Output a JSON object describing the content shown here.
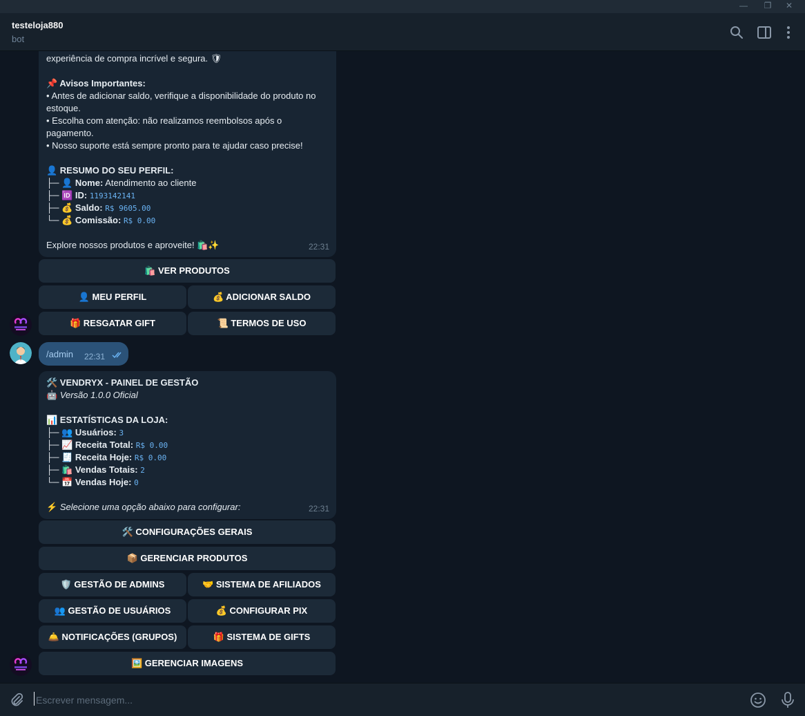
{
  "window": {
    "minimize": "—",
    "restore": "❐",
    "close": "✕"
  },
  "header": {
    "title": "testeloja880",
    "subtitle": "bot",
    "search_icon": "search-icon",
    "sidebar_icon": "sidebar-toggle-icon",
    "menu_icon": "more-vertical-icon"
  },
  "msg1": {
    "lines": [
      "experiência de compra incrível e segura. 🛡",
      "",
      "📌 Avisos Importantes:",
      "• Antes de adicionar saldo, verifique a disponibilidade do produto no",
      "estoque.",
      "• Escolha com atenção: não realizamos reembolsos após o",
      "pagamento.",
      "• Nosso suporte está sempre pronto para te ajudar caso precise!",
      "",
      "👤 RESUMO DO SEU PERFIL:",
      "├─ 👤 Nome: Atendimento ao cliente",
      "├─ 🆔 ID: 1193142141",
      "├─ 💰 Saldo: R$ 9605.00",
      "└─ 💰 Comissão: R$ 0.00",
      "",
      "Explore nossos produtos e aproveite! 🛍️✨"
    ],
    "avisos_heading": "📌 Avisos Importantes:",
    "resumo_heading": "👤 RESUMO DO SEU PERFIL:",
    "nome_label": "Nome:",
    "nome_value": "Atendimento ao cliente",
    "id_label": "ID:",
    "id_value": "1193142141",
    "saldo_label": "Saldo:",
    "saldo_value": "R$ 9605.00",
    "comissao_label": "Comissão:",
    "comissao_value": "R$ 0.00",
    "time": "22:31"
  },
  "keyboard1": {
    "ver_produtos": "🛍️ VER PRODUTOS",
    "meu_perfil": "👤 MEU PERFIL",
    "adicionar_saldo": "💰 ADICIONAR SALDO",
    "resgatar_gift": "🎁 RESGATAR GIFT",
    "termos_de_uso": "📜 TERMOS DE USO"
  },
  "outgoing": {
    "text": "/admin",
    "time": "22:31",
    "status": "read"
  },
  "msg2": {
    "title": "🛠️ VENDRYX - PAINEL DE GESTÃO",
    "version": "Versão 1.0.0 Oficial",
    "stats_heading": "📊 ESTATÍSTICAS DA LOJA:",
    "usuarios_label": "Usuários:",
    "usuarios_value": "3",
    "receita_total_label": "Receita Total:",
    "receita_total_value": "R$ 0.00",
    "receita_hoje_label": "Receita Hoje:",
    "receita_hoje_value": "R$ 0.00",
    "vendas_totais_label": "Vendas Totais:",
    "vendas_totais_value": "2",
    "vendas_hoje_label": "Vendas Hoje:",
    "vendas_hoje_value": "0",
    "prompt": "Selecione uma opção abaixo para configurar:",
    "time": "22:31"
  },
  "keyboard2": {
    "configuracoes_gerais": "🛠️ CONFIGURAÇÕES GERAIS",
    "gerenciar_produtos": "📦 GERENCIAR PRODUTOS",
    "gestao_admins": "🛡️ GESTÃO DE ADMINS",
    "sistema_afiliados": "🤝 SISTEMA DE AFILIADOS",
    "gestao_usuarios": "👥 GESTÃO DE USUÁRIOS",
    "configurar_pix": "💰 CONFIGURAR PIX",
    "notificacoes": "🛎️ NOTIFICAÇÕES (GRUPOS)",
    "sistema_gifts": "🎁 SISTEMA DE GIFTS",
    "gerenciar_imagens": "🖼️ GERENCIAR IMAGENS"
  },
  "input": {
    "placeholder": "Escrever mensagem..."
  },
  "colors": {
    "background": "#0e1621",
    "bubble_in": "#182533",
    "bubble_out": "#2b5278",
    "accent": "#6ab3f3",
    "button": "#1c2a38"
  }
}
